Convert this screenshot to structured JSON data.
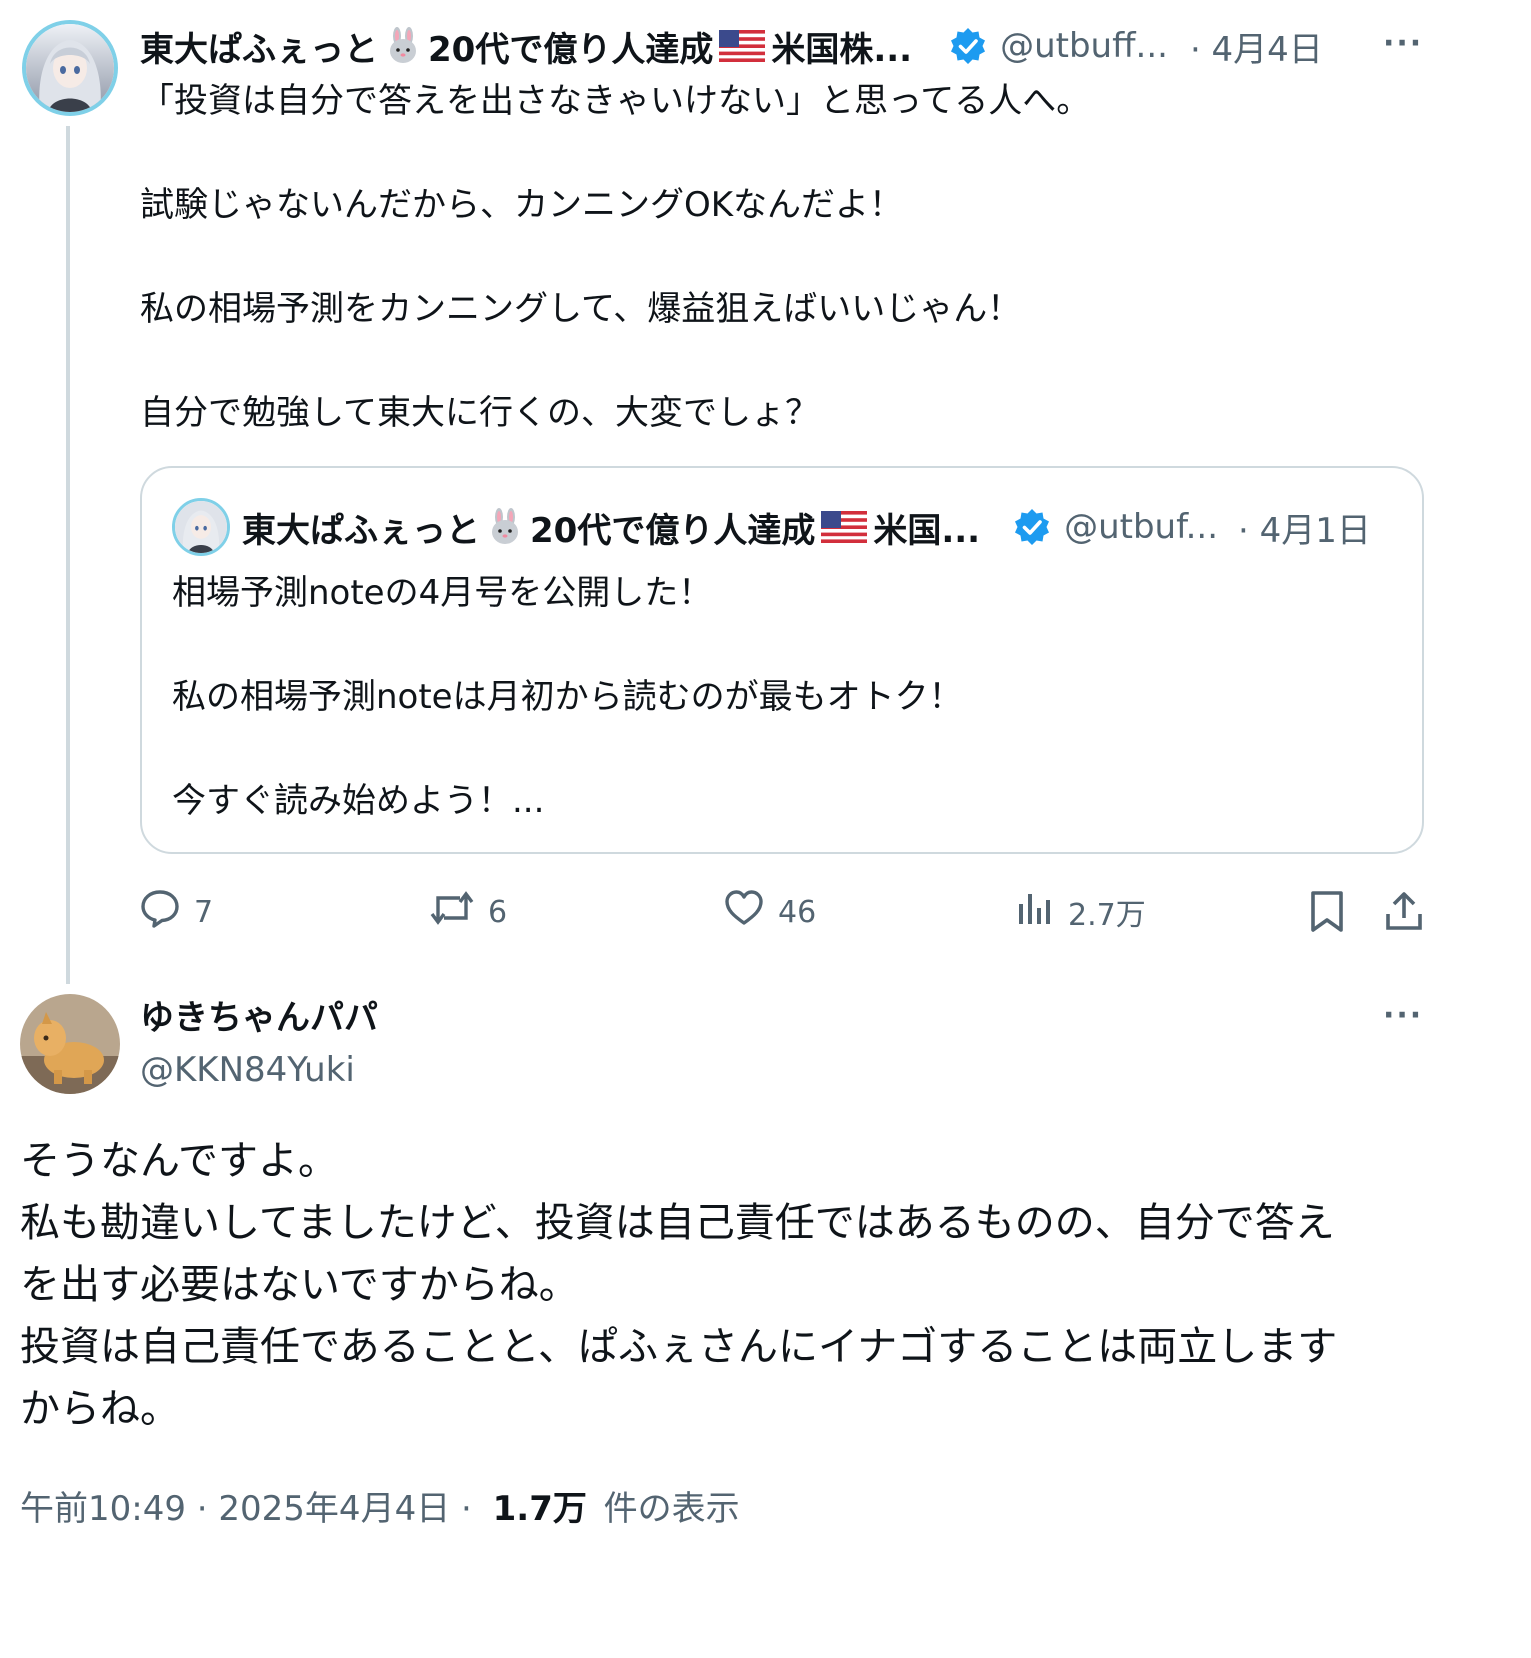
{
  "parent_post": {
    "display_name": "東大ぱふぇっと",
    "display_name_suffix": "20代で億り人達成",
    "display_name_tail": "米国株...",
    "handle": "@utbuff...",
    "date": "· 4月4日",
    "more_icon": "···",
    "text_lines": [
      "「投資は自分で答えを出さなきゃいけない」と思ってる人へ。",
      "試験じゃないんだから、カンニングOKなんだよ！",
      "私の相場予測をカンニングして、爆益狙えばいいじゃん！",
      "自分で勉強して東大に行くの、大変でしょ？"
    ],
    "quoted": {
      "display_name": "東大ぱふぇっと",
      "display_name_suffix": "20代で億り人達成",
      "display_name_tail": "米国...",
      "handle": "@utbuf...",
      "date": "· 4月1日",
      "text_lines": [
        "相場予測noteの4月号を公開した！",
        "私の相場予測noteは月初から読むのが最もオトク！",
        "今すぐ読み始めよう！..."
      ]
    },
    "actions": {
      "reply_count": "7",
      "repost_count": "6",
      "like_count": "46",
      "view_count": "2.7万"
    }
  },
  "reply_post": {
    "display_name": "ゆきちゃんパパ",
    "handle": "@KKN84Yuki",
    "more_icon": "···",
    "text_lines": [
      "そうなんですよ。",
      "私も勘違いしてましたけど、投資は自己責任ではあるものの、自分で答え",
      "を出す必要はないですからね。",
      "投資は自己責任であることと、ぱふぇさんにイナゴすることは両立します",
      "からね。"
    ],
    "timestamp": "午前10:49 · 2025年4月4日 ·",
    "views_count": "1.7万",
    "views_label": "件の表示"
  },
  "colors": {
    "verified_blue": "#1d9bf0",
    "text": "#0f1419",
    "secondary": "#536471",
    "border": "#cfd9de"
  }
}
